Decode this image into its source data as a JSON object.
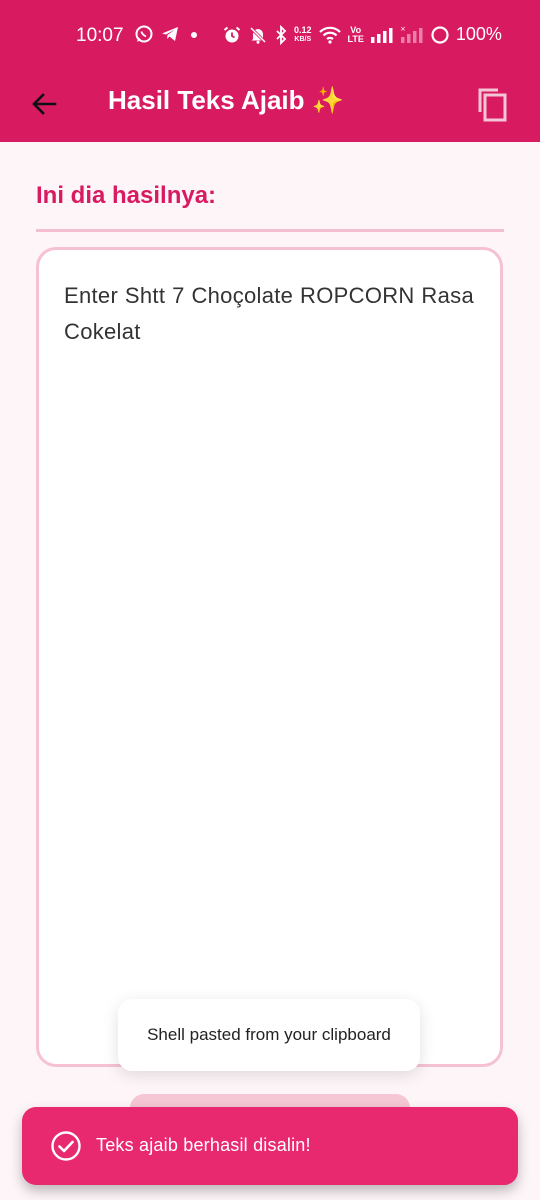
{
  "status_bar": {
    "time": "10:07",
    "net_speed_value": "0.12",
    "net_speed_unit": "KB/S",
    "volte_top": "Vo",
    "volte_bottom": "LTE",
    "battery": "100%",
    "icons": [
      "whatsapp-icon",
      "telegram-icon",
      "dot-icon",
      "alarm-icon",
      "mute-icon",
      "bluetooth-icon",
      "wifi-icon",
      "signal-icon",
      "battery-icon"
    ]
  },
  "app_bar": {
    "title": "Hasil Teks Ajaib ✨",
    "color": "#d81b60"
  },
  "main": {
    "heading": "Ini dia hasilnya:",
    "result_text": "Enter Shtt 7 Choçolate ROPCORN Rasa Cokelat"
  },
  "clipboard_toast": {
    "text": "Shell pasted from your clipboard"
  },
  "snackbar": {
    "message": "Teks ajaib berhasil disalin!",
    "color": "#e8296f"
  }
}
